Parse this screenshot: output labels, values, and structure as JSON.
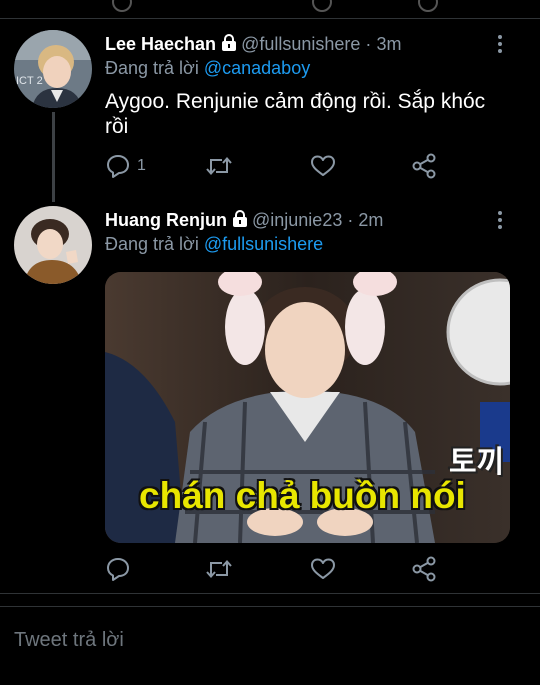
{
  "tweets": [
    {
      "display_name": "Lee Haechan",
      "handle": "@fullsunishere",
      "separator": "·",
      "time": "3m",
      "reply_prefix": "Đang trả lời",
      "reply_to": "@canadaboy",
      "text": "Aygoo. Renjunie cảm động rồi. Sắp khóc rồi",
      "reply_count": "1",
      "avatar_text": "ICT 2"
    },
    {
      "display_name": "Huang Renjun",
      "handle": "@injunie23",
      "separator": "·",
      "time": "2m",
      "reply_prefix": "Đang trả lời",
      "reply_to": "@fullsunishere",
      "media_caption": "chán chả buồn nói",
      "media_overlay": "토끼"
    }
  ],
  "compose": {
    "placeholder": "Tweet trả lời"
  },
  "colors": {
    "background": "#000000",
    "muted": "#8b98a5",
    "link": "#1d9bf0",
    "divider": "#2f3336",
    "caption": "#e8e600"
  },
  "icons": [
    "lock-icon",
    "more-icon",
    "reply-icon",
    "retweet-icon",
    "like-icon",
    "share-icon"
  ]
}
